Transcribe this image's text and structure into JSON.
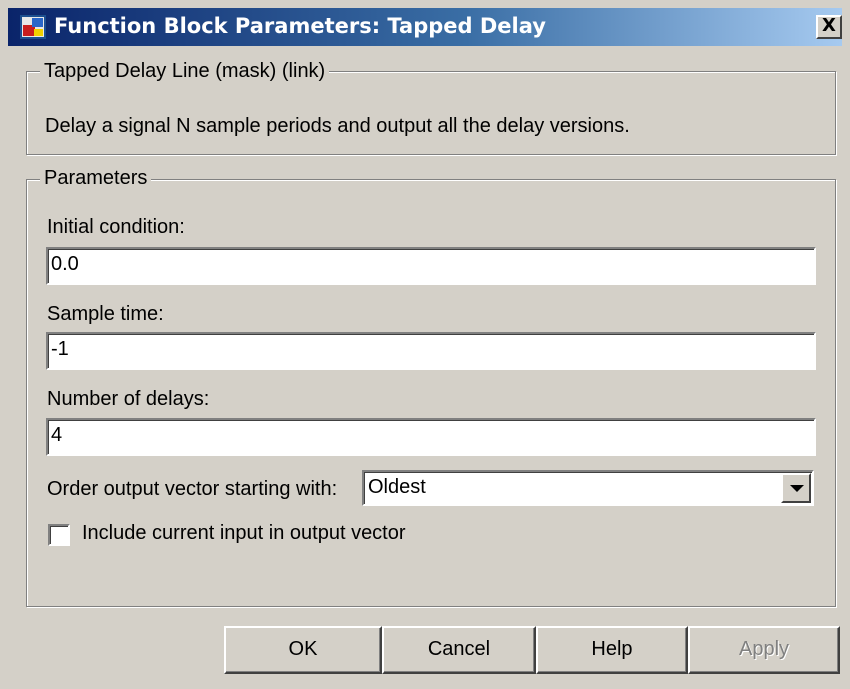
{
  "window": {
    "title": "Function Block Parameters: Tapped Delay",
    "close_label": "X",
    "icon": "simulink-block-icon"
  },
  "description_group": {
    "legend": "Tapped Delay Line (mask) (link)",
    "text": "Delay a signal N sample periods and output all the delay versions."
  },
  "parameters_group": {
    "legend": "Parameters",
    "initial_condition": {
      "label": "Initial condition:",
      "value": "0.0"
    },
    "sample_time": {
      "label": "Sample time:",
      "value": "-1"
    },
    "number_of_delays": {
      "label": "Number of delays:",
      "value": "4"
    },
    "order_output": {
      "label": "Order output vector starting with:",
      "selected": "Oldest"
    },
    "include_current_input": {
      "label": "Include current input in output vector",
      "checked": false
    }
  },
  "buttons": {
    "ok": "OK",
    "cancel": "Cancel",
    "help": "Help",
    "apply": "Apply"
  }
}
